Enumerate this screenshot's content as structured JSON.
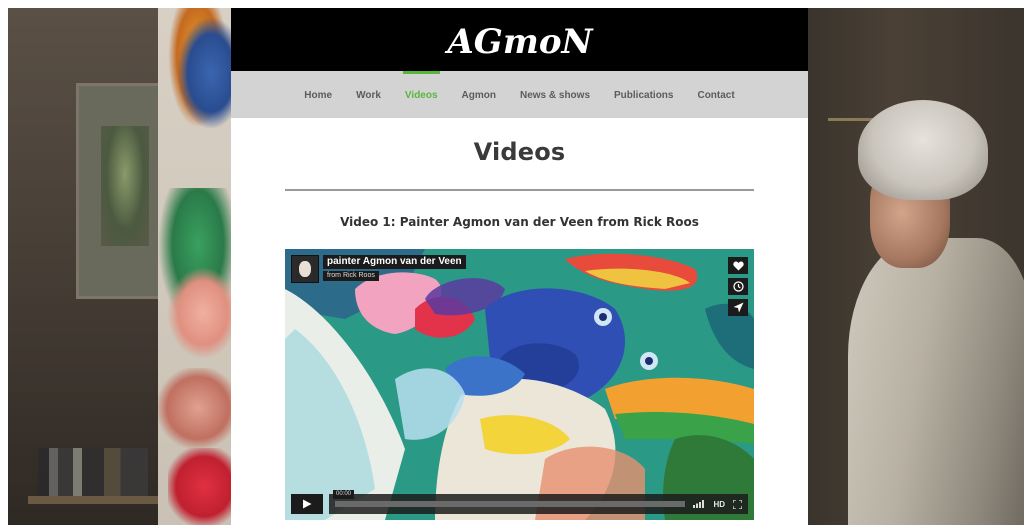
{
  "site": {
    "logo_text": "AGmoN"
  },
  "nav": {
    "items": [
      {
        "label": "Home",
        "active": false
      },
      {
        "label": "Work",
        "active": false
      },
      {
        "label": "Videos",
        "active": true
      },
      {
        "label": "Agmon",
        "active": false
      },
      {
        "label": "News & shows",
        "active": false
      },
      {
        "label": "Publications",
        "active": false
      },
      {
        "label": "Contact",
        "active": false
      }
    ],
    "active_color": "#58b73a"
  },
  "main": {
    "title": "Videos",
    "video_heading": "Video 1: Painter Agmon van der Veen from Rick Roos"
  },
  "player": {
    "title": "painter Agmon van der Veen",
    "byline": "from Rick Roos",
    "time": "00:00",
    "quality": "HD",
    "side_buttons": [
      "heart-icon",
      "clock-icon",
      "send-icon"
    ]
  },
  "colors": {
    "header_bg": "#000000",
    "nav_bg": "#d3d3d3",
    "text_dark": "#3a3a3a"
  }
}
